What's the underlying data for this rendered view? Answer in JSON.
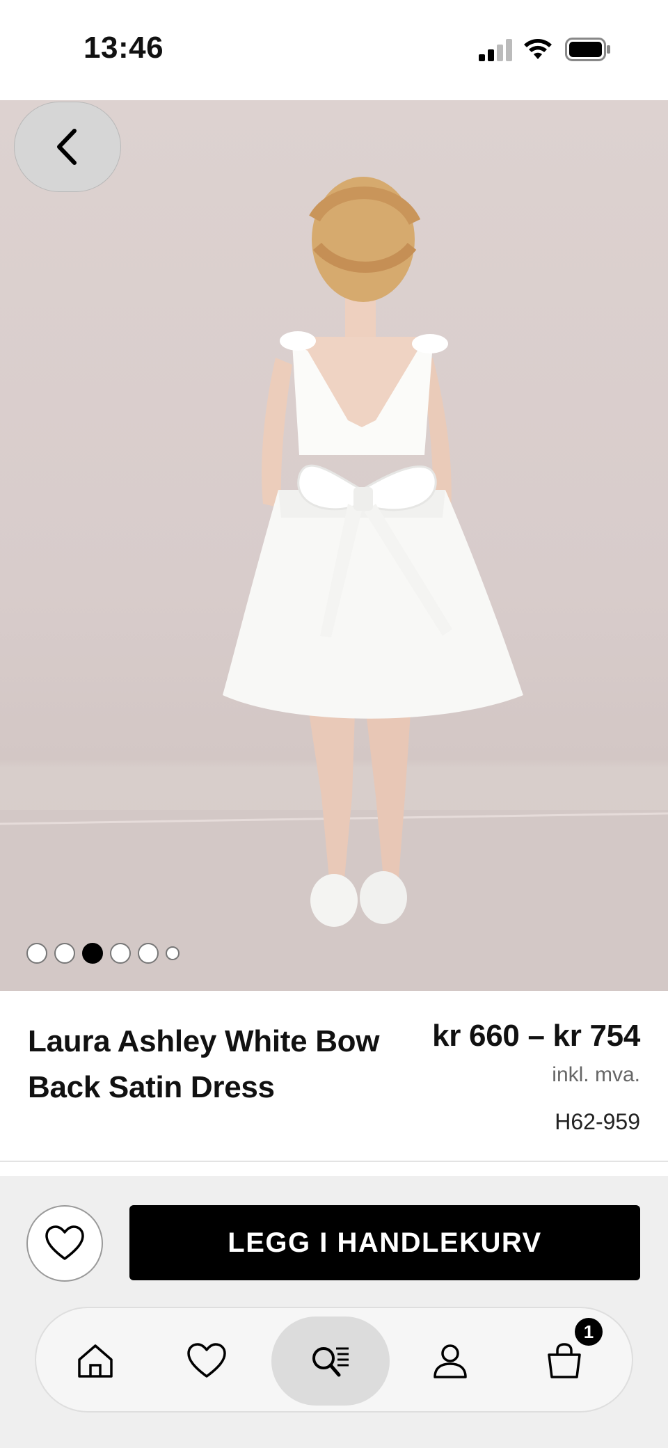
{
  "status_bar": {
    "time": "13:46"
  },
  "product": {
    "title": "Laura Ashley White Bow Back Satin Dress",
    "price": "kr 660 – kr 754",
    "vat_note": "inkl. mva.",
    "sku": "H62-959"
  },
  "gallery": {
    "image_count": 6,
    "active_index": 2
  },
  "actions": {
    "add_to_cart_label": "LEGG I HANDLEKURV"
  },
  "tabbar": {
    "items": [
      {
        "icon": "home-icon"
      },
      {
        "icon": "heart-icon"
      },
      {
        "icon": "search-list-icon",
        "active": true
      },
      {
        "icon": "user-icon"
      },
      {
        "icon": "shopping-bag-icon"
      }
    ],
    "cart_count": "1"
  },
  "colors": {
    "primary": "#000000",
    "background": "#ffffff",
    "bottom_area": "#efefef"
  }
}
